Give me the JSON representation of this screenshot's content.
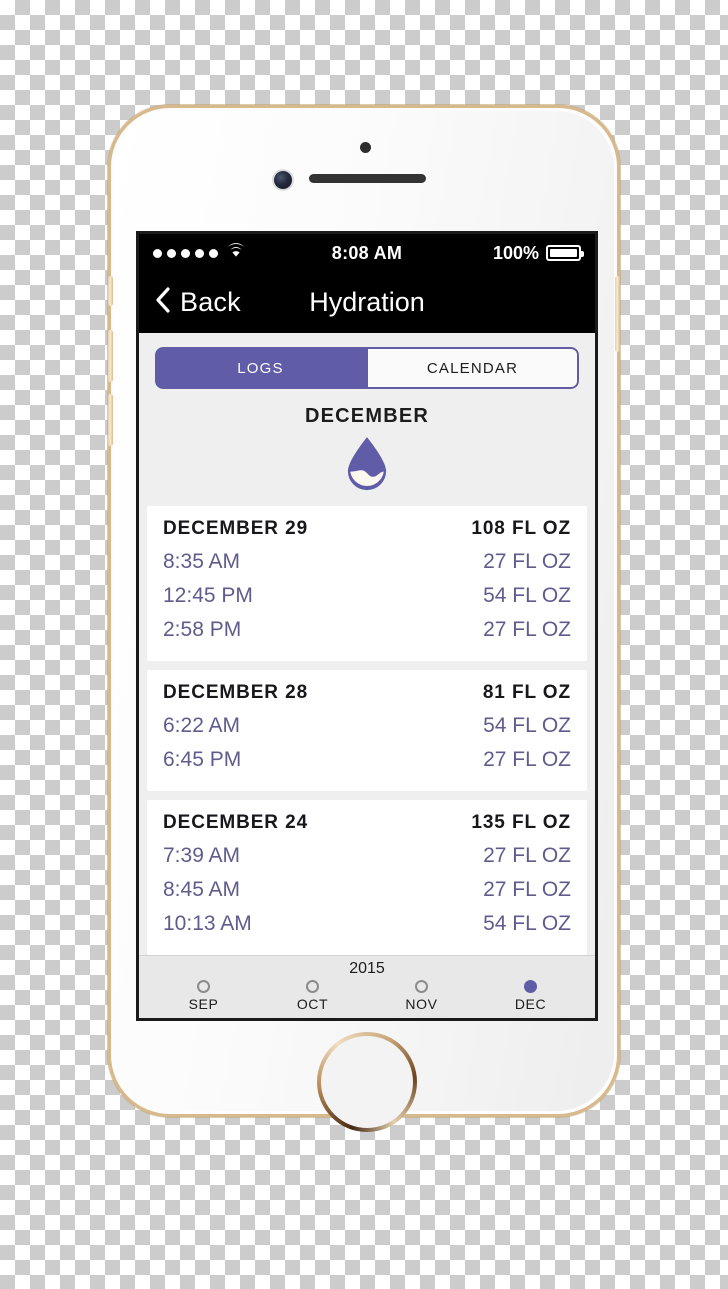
{
  "device": {
    "name": "iphone-gold-white",
    "home_button": "home-button",
    "camera": "front-camera-icon",
    "speaker": "earpiece-speaker",
    "sensor": "proximity-sensor-icon"
  },
  "status_bar": {
    "signal_dots": 5,
    "wifi": "wifi-icon",
    "time": "8:08 AM",
    "battery_percent": "100%",
    "battery_icon": "battery-full-icon"
  },
  "nav": {
    "back_label": "Back",
    "back_icon": "chevron-left-icon",
    "title": "Hydration"
  },
  "segmented": {
    "options": [
      {
        "label": "LOGS",
        "selected": true
      },
      {
        "label": "CALENDAR",
        "selected": false
      }
    ]
  },
  "month_header": {
    "month": "DECEMBER",
    "icon": "water-droplet-icon"
  },
  "logs": [
    {
      "date": "DECEMBER 29",
      "total": "108 FL OZ",
      "entries": [
        {
          "time": "8:35 AM",
          "amount": "27 FL OZ"
        },
        {
          "time": "12:45 PM",
          "amount": "54 FL OZ"
        },
        {
          "time": "2:58 PM",
          "amount": "27 FL OZ"
        }
      ]
    },
    {
      "date": "DECEMBER 28",
      "total": "81 FL OZ",
      "entries": [
        {
          "time": "6:22 AM",
          "amount": "54 FL OZ"
        },
        {
          "time": "6:45 PM",
          "amount": "27 FL OZ"
        }
      ]
    },
    {
      "date": "DECEMBER 24",
      "total": "135 FL OZ",
      "entries": [
        {
          "time": "7:39 AM",
          "amount": "27 FL OZ"
        },
        {
          "time": "8:45 AM",
          "amount": "27 FL OZ"
        },
        {
          "time": "10:13 AM",
          "amount": "54 FL OZ"
        }
      ]
    }
  ],
  "month_picker": {
    "year": "2015",
    "months": [
      {
        "abbr": "SEP",
        "selected": false
      },
      {
        "abbr": "OCT",
        "selected": false
      },
      {
        "abbr": "NOV",
        "selected": false
      },
      {
        "abbr": "DEC",
        "selected": true
      }
    ]
  },
  "colors": {
    "accent_purple": "#605ca8",
    "entry_text": "#5f5c8c",
    "screen_bg": "#efefef",
    "card_bg": "#ffffff",
    "bar_black": "#000000",
    "device_gold": "#d8b98c"
  }
}
